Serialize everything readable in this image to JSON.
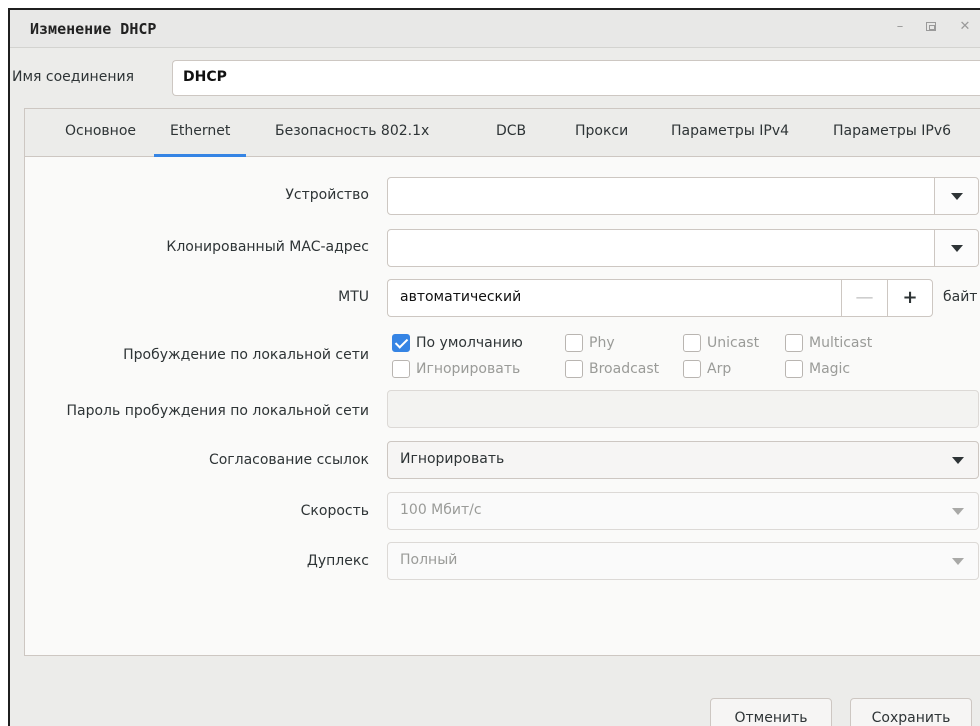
{
  "window": {
    "title": "Изменение  DHCP",
    "controls": {
      "minimize": "–",
      "maximize_icon": "maximize-icon",
      "close": "✕"
    }
  },
  "connection": {
    "label": "Имя соединения",
    "value": "DHCP"
  },
  "tabs": [
    {
      "label": "Основное",
      "active": false
    },
    {
      "label": "Ethernet",
      "active": true
    },
    {
      "label": "Безопасность 802.1x",
      "active": false
    },
    {
      "label": "DCB",
      "active": false
    },
    {
      "label": "Прокси",
      "active": false
    },
    {
      "label": "Параметры IPv4",
      "active": false
    },
    {
      "label": "Параметры IPv6",
      "active": false
    }
  ],
  "ethernet": {
    "device": {
      "label": "Устройство",
      "value": ""
    },
    "cloned_mac": {
      "label": "Клонированный MAC-адрес",
      "value": ""
    },
    "mtu": {
      "label": "MTU",
      "value": "автоматический",
      "minus": "—",
      "plus": "+",
      "unit": "байт"
    },
    "wol": {
      "label": "Пробуждение по локальной сети",
      "options": [
        {
          "label": "По умолчанию",
          "checked": true
        },
        {
          "label": "Phy",
          "checked": false
        },
        {
          "label": "Unicast",
          "checked": false
        },
        {
          "label": "Multicast",
          "checked": false
        },
        {
          "label": "Игнорировать",
          "checked": false
        },
        {
          "label": "Broadcast",
          "checked": false
        },
        {
          "label": "Arp",
          "checked": false
        },
        {
          "label": "Magic",
          "checked": false
        }
      ]
    },
    "wol_password": {
      "label": "Пароль пробуждения по локальной сети",
      "value": ""
    },
    "link_negotiation": {
      "label": "Согласование ссылок",
      "value": "Игнорировать"
    },
    "speed": {
      "label": "Скорость",
      "value": "100 Мбит/с"
    },
    "duplex": {
      "label": "Дуплекс",
      "value": "Полный"
    }
  },
  "buttons": {
    "cancel": "Отменить",
    "save": "Сохранить"
  },
  "colors": {
    "accent": "#3584e4",
    "window_bg": "#ececea"
  }
}
